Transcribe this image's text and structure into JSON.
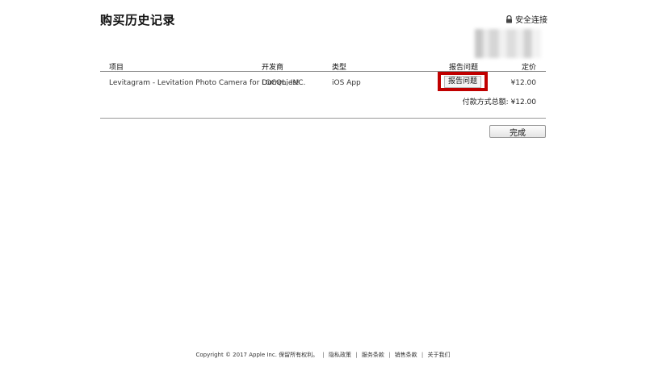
{
  "header": {
    "title": "购买历史记录",
    "secure_label": "安全连接"
  },
  "table": {
    "columns": {
      "item": "项目",
      "developer": "开发商",
      "type": "类型",
      "report": "报告问题",
      "price": "定价"
    },
    "rows": [
      {
        "item": "Levitagram - Levitation Photo Camera for Dummies!",
        "developer": "LOCQL, INC.",
        "type": "iOS App",
        "report_label": "报告问题",
        "price": "¥12.00"
      }
    ],
    "total_label": "付款方式总额:",
    "total_value": "¥12.00"
  },
  "actions": {
    "done_label": "完成"
  },
  "footer": {
    "copyright": "Copyright © 2017 Apple Inc. 保留所有权利。",
    "links": [
      "隐私政策",
      "服务条款",
      "销售条款",
      "关于我们"
    ]
  },
  "colors": {
    "highlight_border": "#c00000"
  }
}
